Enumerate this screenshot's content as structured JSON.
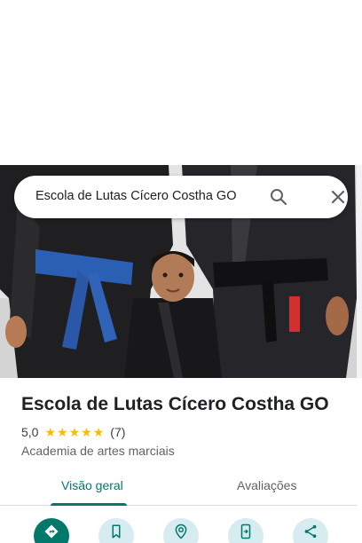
{
  "search": {
    "query": "Escola de Lutas Cícero Costha GO"
  },
  "place": {
    "title": "Escola de Lutas Cícero Costha GO",
    "rating": "5,0",
    "stars": [
      "★",
      "★",
      "★",
      "★",
      "★"
    ],
    "review_count": "(7)",
    "category": "Academia de artes marciais"
  },
  "tabs": [
    {
      "label": "Visão geral",
      "active": true
    },
    {
      "label": "Avaliações",
      "active": false
    }
  ],
  "actions": [
    {
      "name": "directions",
      "icon": "directions-icon"
    },
    {
      "name": "save",
      "icon": "bookmark-icon"
    },
    {
      "name": "nearby",
      "icon": "nearby-icon"
    },
    {
      "name": "send-to-phone",
      "icon": "send-to-phone-icon"
    },
    {
      "name": "share",
      "icon": "share-icon"
    }
  ],
  "colors": {
    "accent": "#01796f",
    "star": "#fbbc04",
    "action_bg": "#d7ecf0"
  }
}
